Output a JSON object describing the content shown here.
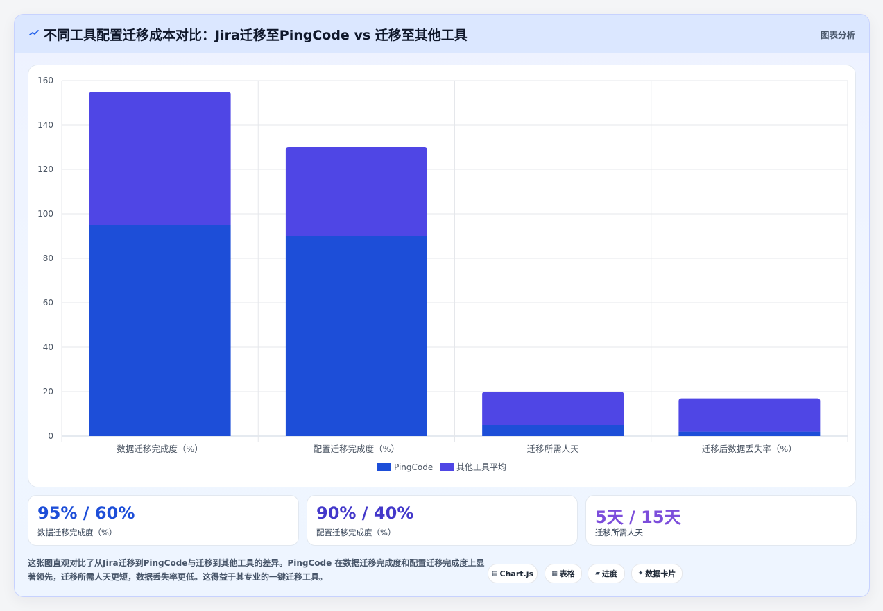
{
  "header": {
    "title": "不同工具配置迁移成本对比：Jira迁移至PingCode vs 迁移至其他工具",
    "tag": "图表分析"
  },
  "chart_data": {
    "type": "bar",
    "stacked": true,
    "categories": [
      "数据迁移完成度（%）",
      "配置迁移完成度（%）",
      "迁移所需人天",
      "迁移后数据丢失率（%）"
    ],
    "series": [
      {
        "name": "PingCode",
        "values": [
          95,
          90,
          5,
          2
        ],
        "color": "#1d4ed8"
      },
      {
        "name": "其他工具平均",
        "values": [
          60,
          40,
          15,
          15
        ],
        "color": "#4f46e5"
      }
    ],
    "ylim": [
      0,
      160
    ],
    "yticks": [
      0,
      20,
      40,
      60,
      80,
      100,
      120,
      140,
      160
    ],
    "grid": true,
    "legend": "bottom"
  },
  "stats": [
    {
      "value": "95% / 60%",
      "label": "数据迁移完成度（%）",
      "color": "#1d4ed8"
    },
    {
      "value": "90% / 40%",
      "label": "配置迁移完成度（%）",
      "color": "#4338ca"
    },
    {
      "value": "5天 / 15天",
      "label": "迁移所需人天",
      "color": "#7c4ddb"
    }
  ],
  "description": "这张图直观对比了从Jira迁移到PingCode与迁移到其他工具的差异。PingCode 在数据迁移完成度和配置迁移完成度上显著领先，迁移所需人天更短，数据丢失率更低。这得益于其专业的一键迁移工具。",
  "chips": [
    {
      "icon": "▤",
      "label": "Chart.js"
    },
    {
      "icon": "▦",
      "label": "表格"
    },
    {
      "icon": "▰",
      "label": "进度"
    },
    {
      "icon": "✦",
      "label": "数据卡片"
    }
  ]
}
